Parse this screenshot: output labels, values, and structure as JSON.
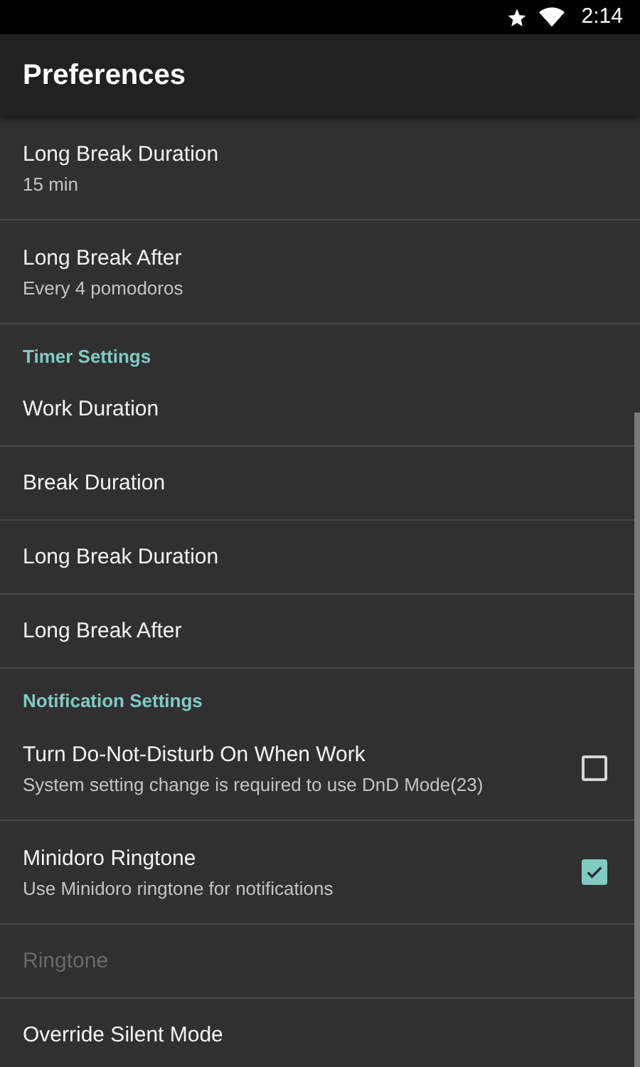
{
  "status_bar": {
    "time": "2:14"
  },
  "toolbar": {
    "title": "Preferences"
  },
  "items": [
    {
      "kind": "pref",
      "title": "Long Break Duration",
      "summary": "15 min",
      "disabled": false
    },
    {
      "kind": "pref",
      "title": "Long Break After",
      "summary": "Every 4 pomodoros",
      "disabled": false
    },
    {
      "kind": "header",
      "title": "Timer Settings"
    },
    {
      "kind": "pref",
      "title": "Work Duration",
      "disabled": false
    },
    {
      "kind": "pref",
      "title": "Break Duration",
      "disabled": false
    },
    {
      "kind": "pref",
      "title": "Long Break Duration",
      "disabled": false
    },
    {
      "kind": "pref",
      "title": "Long Break After",
      "disabled": false
    },
    {
      "kind": "header",
      "title": "Notification Settings"
    },
    {
      "kind": "check",
      "title": "Turn Do-Not-Disturb On When Work",
      "summary": "System setting change is required to use DnD Mode(23)",
      "checked": false,
      "disabled": false
    },
    {
      "kind": "check",
      "title": "Minidoro Ringtone",
      "summary": "Use Minidoro ringtone for notifications",
      "checked": true,
      "disabled": false
    },
    {
      "kind": "pref",
      "title": "Ringtone",
      "disabled": true
    },
    {
      "kind": "pref",
      "title": "Override Silent Mode",
      "disabled": false
    }
  ]
}
